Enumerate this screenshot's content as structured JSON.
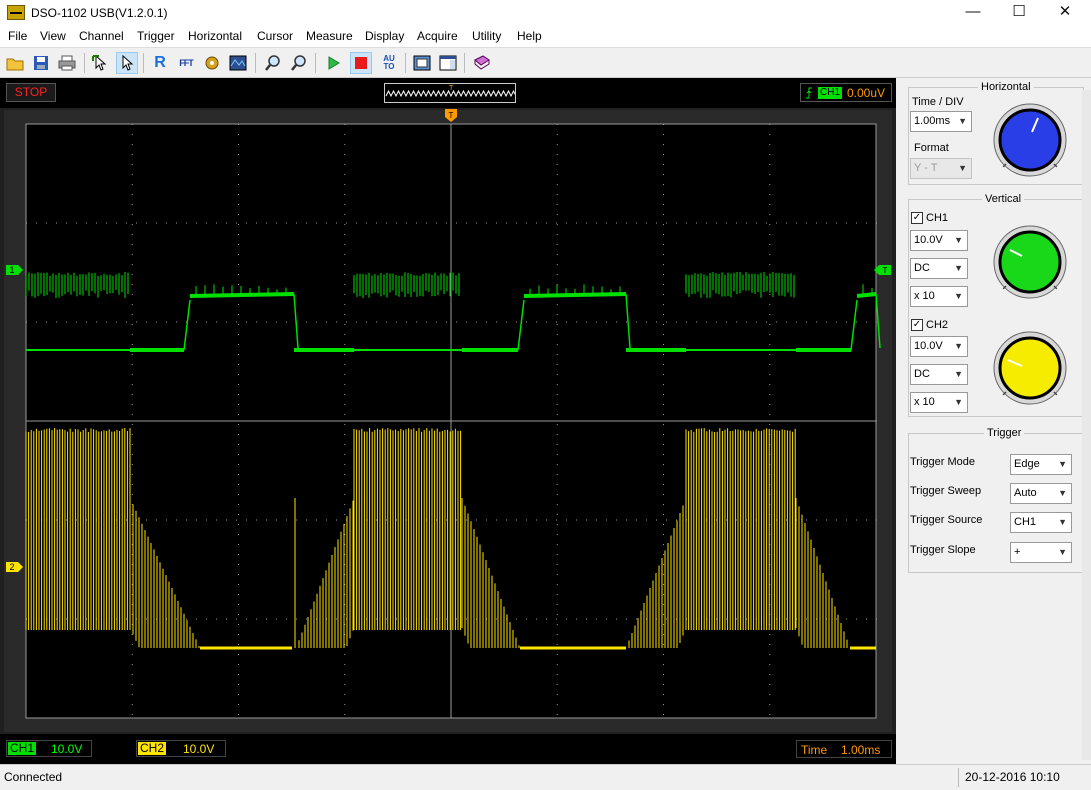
{
  "window": {
    "title": "DSO-1102 USB(V1.2.0.1)",
    "controls": [
      "—",
      "☐",
      "✕"
    ]
  },
  "menu": [
    "File",
    "View",
    "Channel",
    "Trigger",
    "Horizontal",
    "Cursor",
    "Measure",
    "Display",
    "Acquire",
    "Utility",
    "Help"
  ],
  "toolbar": {
    "icons": [
      "open-folder-icon",
      "save-icon",
      "print-icon",
      "pointer-cursor-icon",
      "select-arrow-icon",
      "ref-icon",
      "fft-icon",
      "math-icon",
      "display-icon",
      "zoom-in-icon",
      "zoom-out-icon",
      "run-icon",
      "stop-icon",
      "auto-icon",
      "screenshot-icon",
      "window-icon",
      "book-icon"
    ],
    "ref_label": "R",
    "fft_label": "FFT",
    "auto_label": "AU TO"
  },
  "scope": {
    "status": "STOP",
    "trigger_marker": "T",
    "trigger_channel": "CH1",
    "trigger_level": "0.00uV",
    "ch1_marker": "1",
    "ch2_marker": "2",
    "level_marker": "T",
    "ch1_label": "CH1",
    "ch1_scale": "10.0V",
    "ch2_label": "CH2",
    "ch2_scale": "10.0V",
    "time_label": "Time",
    "time_value": "1.00ms",
    "colors": {
      "ch1": "#00e000",
      "ch2": "#ffe400",
      "trigger": "#ff9a00",
      "grid": "#9a9a9a"
    }
  },
  "panel": {
    "horizontal": {
      "title": "Horizontal",
      "time_div_label": "Time / DIV",
      "time_div_value": "1.00ms",
      "format_label": "Format",
      "format_value": "Y - T"
    },
    "vertical": {
      "title": "Vertical",
      "ch1": {
        "label": "CH1",
        "checked": true,
        "volts": "10.0V",
        "coupling": "DC",
        "probe": "x 10"
      },
      "ch2": {
        "label": "CH2",
        "checked": true,
        "volts": "10.0V",
        "coupling": "DC",
        "probe": "x 10"
      }
    },
    "trigger": {
      "title": "Trigger",
      "mode_label": "Trigger Mode",
      "mode_value": "Edge",
      "sweep_label": "Trigger Sweep",
      "sweep_value": "Auto",
      "source_label": "Trigger Source",
      "source_value": "CH1",
      "slope_label": "Trigger Slope",
      "slope_value": "+"
    }
  },
  "status": {
    "connection": "Connected",
    "datetime": "20-12-2016  10:10"
  }
}
